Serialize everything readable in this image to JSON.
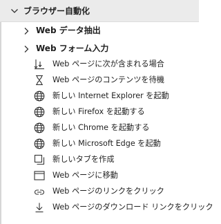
{
  "category": {
    "title": "ブラウザー自動化",
    "expanded": true
  },
  "subgroups": [
    {
      "label": "Web データ抽出",
      "expanded": false
    },
    {
      "label": "Web フォーム入力",
      "expanded": false
    }
  ],
  "actions": [
    {
      "label": "Web ページに次が含まれる場合",
      "icon": "web-page-contains-icon"
    },
    {
      "label": "Web ページのコンテンツを待機",
      "icon": "hourglass-icon"
    },
    {
      "label": "新しい Internet Explorer を起動",
      "icon": "globe-icon"
    },
    {
      "label": "新しい Firefox を起動する",
      "icon": "globe-icon"
    },
    {
      "label": "新しい Chrome を起動する",
      "icon": "globe-icon"
    },
    {
      "label": "新しい Microsoft Edge を起動",
      "icon": "globe-icon"
    },
    {
      "label": "新しいタブを作成",
      "icon": "new-tab-icon"
    },
    {
      "label": "Web ページに移動",
      "icon": "browser-window-icon"
    },
    {
      "label": "Web ページのリンクをクリック",
      "icon": "link-icon"
    },
    {
      "label": "Web ページのダウンロード リンクをクリック",
      "icon": "download-icon"
    }
  ]
}
